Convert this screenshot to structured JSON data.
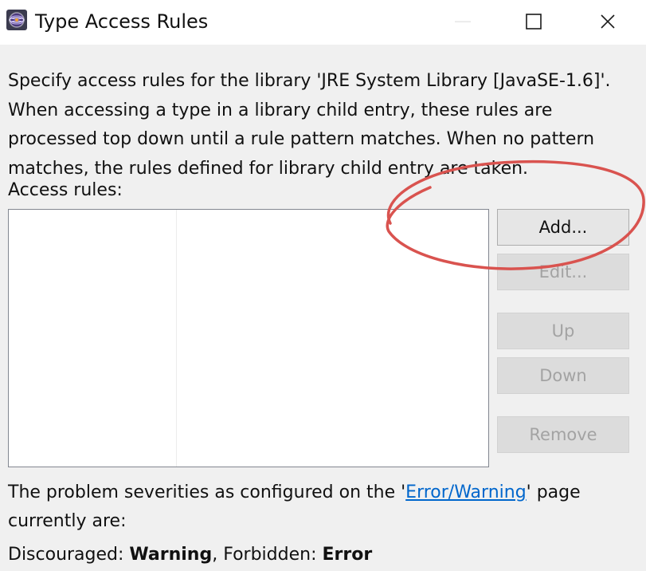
{
  "window": {
    "title": "Type Access Rules"
  },
  "description": {
    "lines": [
      "Specify access rules for the library 'JRE System Library [JavaSE-1.6]'.",
      "When accessing a type in a library child entry, these rules are",
      "processed top down until a rule pattern matches. When no pattern",
      "matches, the rules defined for library child entry are taken."
    ]
  },
  "access_rules": {
    "label": "Access rules:",
    "rows": []
  },
  "buttons": {
    "add": "Add...",
    "edit": "Edit...",
    "up": "Up",
    "down": "Down",
    "remove": "Remove"
  },
  "severity": {
    "before_link": "The problem severities as configured on the '",
    "link": "Error/Warning",
    "after_link": "' page",
    "second_line": "currently are:"
  },
  "summary": {
    "discouraged_label": "Discouraged: ",
    "discouraged_value": "Warning",
    "separator": ", Forbidden: ",
    "forbidden_value": "Error"
  },
  "colors": {
    "link": "#0066cc",
    "annotation": "#d9534f",
    "disabled_text": "#a3a3a3"
  },
  "icons": {
    "app": "eclipse-icon",
    "minimize": "minimize-icon",
    "maximize": "maximize-icon",
    "close": "close-icon"
  }
}
